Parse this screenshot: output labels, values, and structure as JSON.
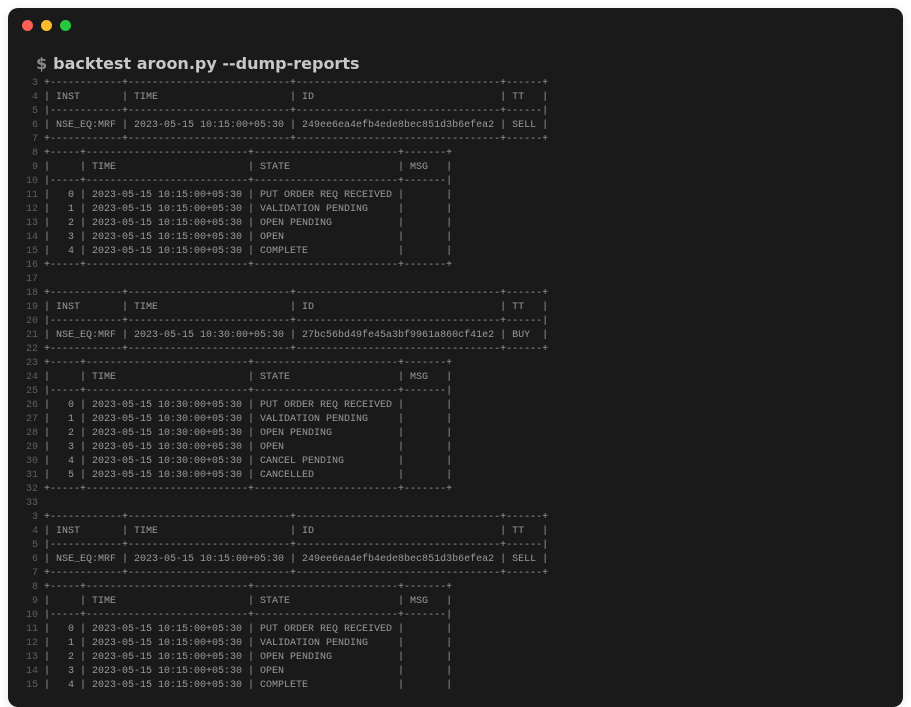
{
  "prompt": {
    "symbol": "$",
    "command": "backtest aroon.py --dump-reports"
  },
  "lines": [
    {
      "n": "3",
      "t": "+------------+---------------------------+----------------------------------+------+"
    },
    {
      "n": "4",
      "t": "| INST       | TIME                      | ID                               | TT   |"
    },
    {
      "n": "5",
      "t": "|------------+---------------------------+----------------------------------+------|"
    },
    {
      "n": "6",
      "t": "| NSE_EQ:MRF | 2023-05-15 10:15:00+05:30 | 249ee6ea4efb4ede8bec851d3b6efea2 | SELL |"
    },
    {
      "n": "7",
      "t": "+------------+---------------------------+----------------------------------+------+"
    },
    {
      "n": "8",
      "t": "+-----+---------------------------+------------------------+-------+"
    },
    {
      "n": "9",
      "t": "|     | TIME                      | STATE                  | MSG   |"
    },
    {
      "n": "10",
      "t": "|-----+---------------------------+------------------------+-------|"
    },
    {
      "n": "11",
      "t": "|   0 | 2023-05-15 10:15:00+05:30 | PUT ORDER REQ RECEIVED |       |"
    },
    {
      "n": "12",
      "t": "|   1 | 2023-05-15 10:15:00+05:30 | VALIDATION PENDING     |       |"
    },
    {
      "n": "13",
      "t": "|   2 | 2023-05-15 10:15:00+05:30 | OPEN PENDING           |       |"
    },
    {
      "n": "14",
      "t": "|   3 | 2023-05-15 10:15:00+05:30 | OPEN                   |       |"
    },
    {
      "n": "15",
      "t": "|   4 | 2023-05-15 10:15:00+05:30 | COMPLETE               |       |"
    },
    {
      "n": "16",
      "t": "+-----+---------------------------+------------------------+-------+"
    },
    {
      "n": "17",
      "t": ""
    },
    {
      "n": "18",
      "t": "+------------+---------------------------+----------------------------------+------+"
    },
    {
      "n": "19",
      "t": "| INST       | TIME                      | ID                               | TT   |"
    },
    {
      "n": "20",
      "t": "|------------+---------------------------+----------------------------------+------|"
    },
    {
      "n": "21",
      "t": "| NSE_EQ:MRF | 2023-05-15 10:30:00+05:30 | 27bc56bd49fe45a3bf9961a860cf41e2 | BUY  |"
    },
    {
      "n": "22",
      "t": "+------------+---------------------------+----------------------------------+------+"
    },
    {
      "n": "23",
      "t": "+-----+---------------------------+------------------------+-------+"
    },
    {
      "n": "24",
      "t": "|     | TIME                      | STATE                  | MSG   |"
    },
    {
      "n": "25",
      "t": "|-----+---------------------------+------------------------+-------|"
    },
    {
      "n": "26",
      "t": "|   0 | 2023-05-15 10:30:00+05:30 | PUT ORDER REQ RECEIVED |       |"
    },
    {
      "n": "27",
      "t": "|   1 | 2023-05-15 10:30:00+05:30 | VALIDATION PENDING     |       |"
    },
    {
      "n": "28",
      "t": "|   2 | 2023-05-15 10:30:00+05:30 | OPEN PENDING           |       |"
    },
    {
      "n": "29",
      "t": "|   3 | 2023-05-15 10:30:00+05:30 | OPEN                   |       |"
    },
    {
      "n": "30",
      "t": "|   4 | 2023-05-15 10:30:00+05:30 | CANCEL PENDING         |       |"
    },
    {
      "n": "31",
      "t": "|   5 | 2023-05-15 10:30:00+05:30 | CANCELLED              |       |"
    },
    {
      "n": "32",
      "t": "+-----+---------------------------+------------------------+-------+"
    },
    {
      "n": "33",
      "t": ""
    },
    {
      "n": "3",
      "t": "+------------+---------------------------+----------------------------------+------+"
    },
    {
      "n": "4",
      "t": "| INST       | TIME                      | ID                               | TT   |"
    },
    {
      "n": "5",
      "t": "|------------+---------------------------+----------------------------------+------|"
    },
    {
      "n": "6",
      "t": "| NSE_EQ:MRF | 2023-05-15 10:15:00+05:30 | 249ee6ea4efb4ede8bec851d3b6efea2 | SELL |"
    },
    {
      "n": "7",
      "t": "+------------+---------------------------+----------------------------------+------+"
    },
    {
      "n": "8",
      "t": "+-----+---------------------------+------------------------+-------+"
    },
    {
      "n": "9",
      "t": "|     | TIME                      | STATE                  | MSG   |"
    },
    {
      "n": "10",
      "t": "|-----+---------------------------+------------------------+-------|"
    },
    {
      "n": "11",
      "t": "|   0 | 2023-05-15 10:15:00+05:30 | PUT ORDER REQ RECEIVED |       |"
    },
    {
      "n": "12",
      "t": "|   1 | 2023-05-15 10:15:00+05:30 | VALIDATION PENDING     |       |"
    },
    {
      "n": "13",
      "t": "|   2 | 2023-05-15 10:15:00+05:30 | OPEN PENDING           |       |"
    },
    {
      "n": "14",
      "t": "|   3 | 2023-05-15 10:15:00+05:30 | OPEN                   |       |"
    },
    {
      "n": "15",
      "t": "|   4 | 2023-05-15 10:15:00+05:30 | COMPLETE               |       |"
    }
  ]
}
